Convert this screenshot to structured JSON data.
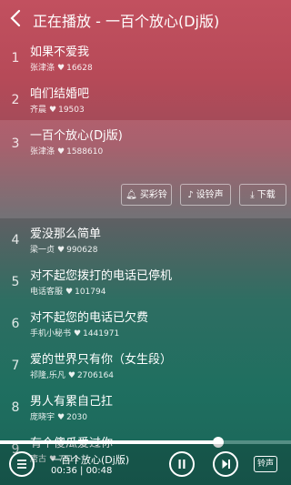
{
  "header": {
    "title": "正在播放 - 一百个放心(Dj版)"
  },
  "songs": [
    {
      "index": "1",
      "title": "如果不爱我",
      "artist": "张津涤",
      "likes": "16628"
    },
    {
      "index": "2",
      "title": "咱们结婚吧",
      "artist": "齐晨",
      "likes": "19503"
    },
    {
      "index": "3",
      "title": "一百个放心(Dj版)",
      "artist": "张津涤",
      "likes": "1588610"
    },
    {
      "index": "4",
      "title": "爱没那么简单",
      "artist": "梁一贞",
      "likes": "990628"
    },
    {
      "index": "5",
      "title": "对不起您拨打的电话已停机",
      "artist": "电话客服",
      "likes": "101794"
    },
    {
      "index": "6",
      "title": "对不起您的电话已欠费",
      "artist": "手机小秘书",
      "likes": "1441971"
    },
    {
      "index": "7",
      "title": "爱的世界只有你（女生段）",
      "artist": "祁隆,乐凡",
      "likes": "2706164"
    },
    {
      "index": "8",
      "title": "男人有累自己扛",
      "artist": "庞晓宇",
      "likes": "2030"
    },
    {
      "index": "9",
      "title": "有个傻瓜爱过你",
      "artist": "唐古",
      "likes": "7811"
    }
  ],
  "actions": {
    "ringtone": "买彩铃",
    "set_ring": "设铃声",
    "download": "下载"
  },
  "player": {
    "title": "一百个放心(Dj版)",
    "current_time": "00:36",
    "total_time": "00:48",
    "progress": 0.75,
    "ring_label": "铃声"
  },
  "colors": {
    "bg_top": "#c2505f",
    "bg_bottom": "#1f6f60",
    "text": "#ffffff"
  },
  "icons": {
    "back": "chevron-left-icon",
    "heart": "heart-icon",
    "bell": "bell-icon",
    "note": "music-note-icon",
    "download": "download-icon",
    "menu": "list-icon",
    "pause": "pause-icon",
    "next": "skip-next-icon"
  }
}
